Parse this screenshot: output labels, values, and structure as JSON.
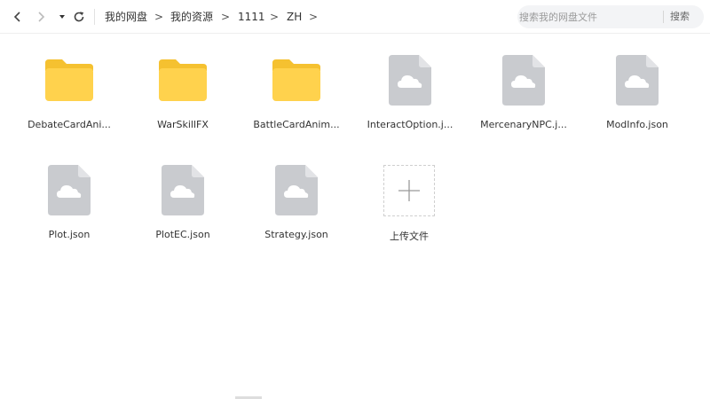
{
  "toolbar": {
    "back_icon": "chevron-left-icon",
    "forward_icon": "chevron-right-icon",
    "history_dropdown_icon": "caret-down-icon",
    "refresh_icon": "refresh-icon",
    "breadcrumbs": [
      {
        "label": "我的网盘"
      },
      {
        "label": "我的资源"
      },
      {
        "label": "1111"
      },
      {
        "label": "ZH"
      }
    ],
    "separator": ">"
  },
  "search": {
    "placeholder": "搜索我的网盘文件",
    "button_label": "搜索"
  },
  "files": [
    {
      "name": "DebateCardAni...",
      "type": "folder"
    },
    {
      "name": "WarSkillFX",
      "type": "folder"
    },
    {
      "name": "BattleCardAnim...",
      "type": "folder"
    },
    {
      "name": "InteractOption.j...",
      "type": "file"
    },
    {
      "name": "MercenaryNPC.j...",
      "type": "file"
    },
    {
      "name": "ModInfo.json",
      "type": "file"
    },
    {
      "name": "Plot.json",
      "type": "file"
    },
    {
      "name": "PlotEC.json",
      "type": "file"
    },
    {
      "name": "Strategy.json",
      "type": "file"
    }
  ],
  "upload": {
    "label": "上传文件",
    "icon": "plus-icon"
  },
  "colors": {
    "folder": "#FFD24D",
    "folder_tab": "#F5C130",
    "file_doc": "#C9CBCF",
    "file_fold": "#E2E3E6",
    "cloud": "#FFFFFF"
  }
}
